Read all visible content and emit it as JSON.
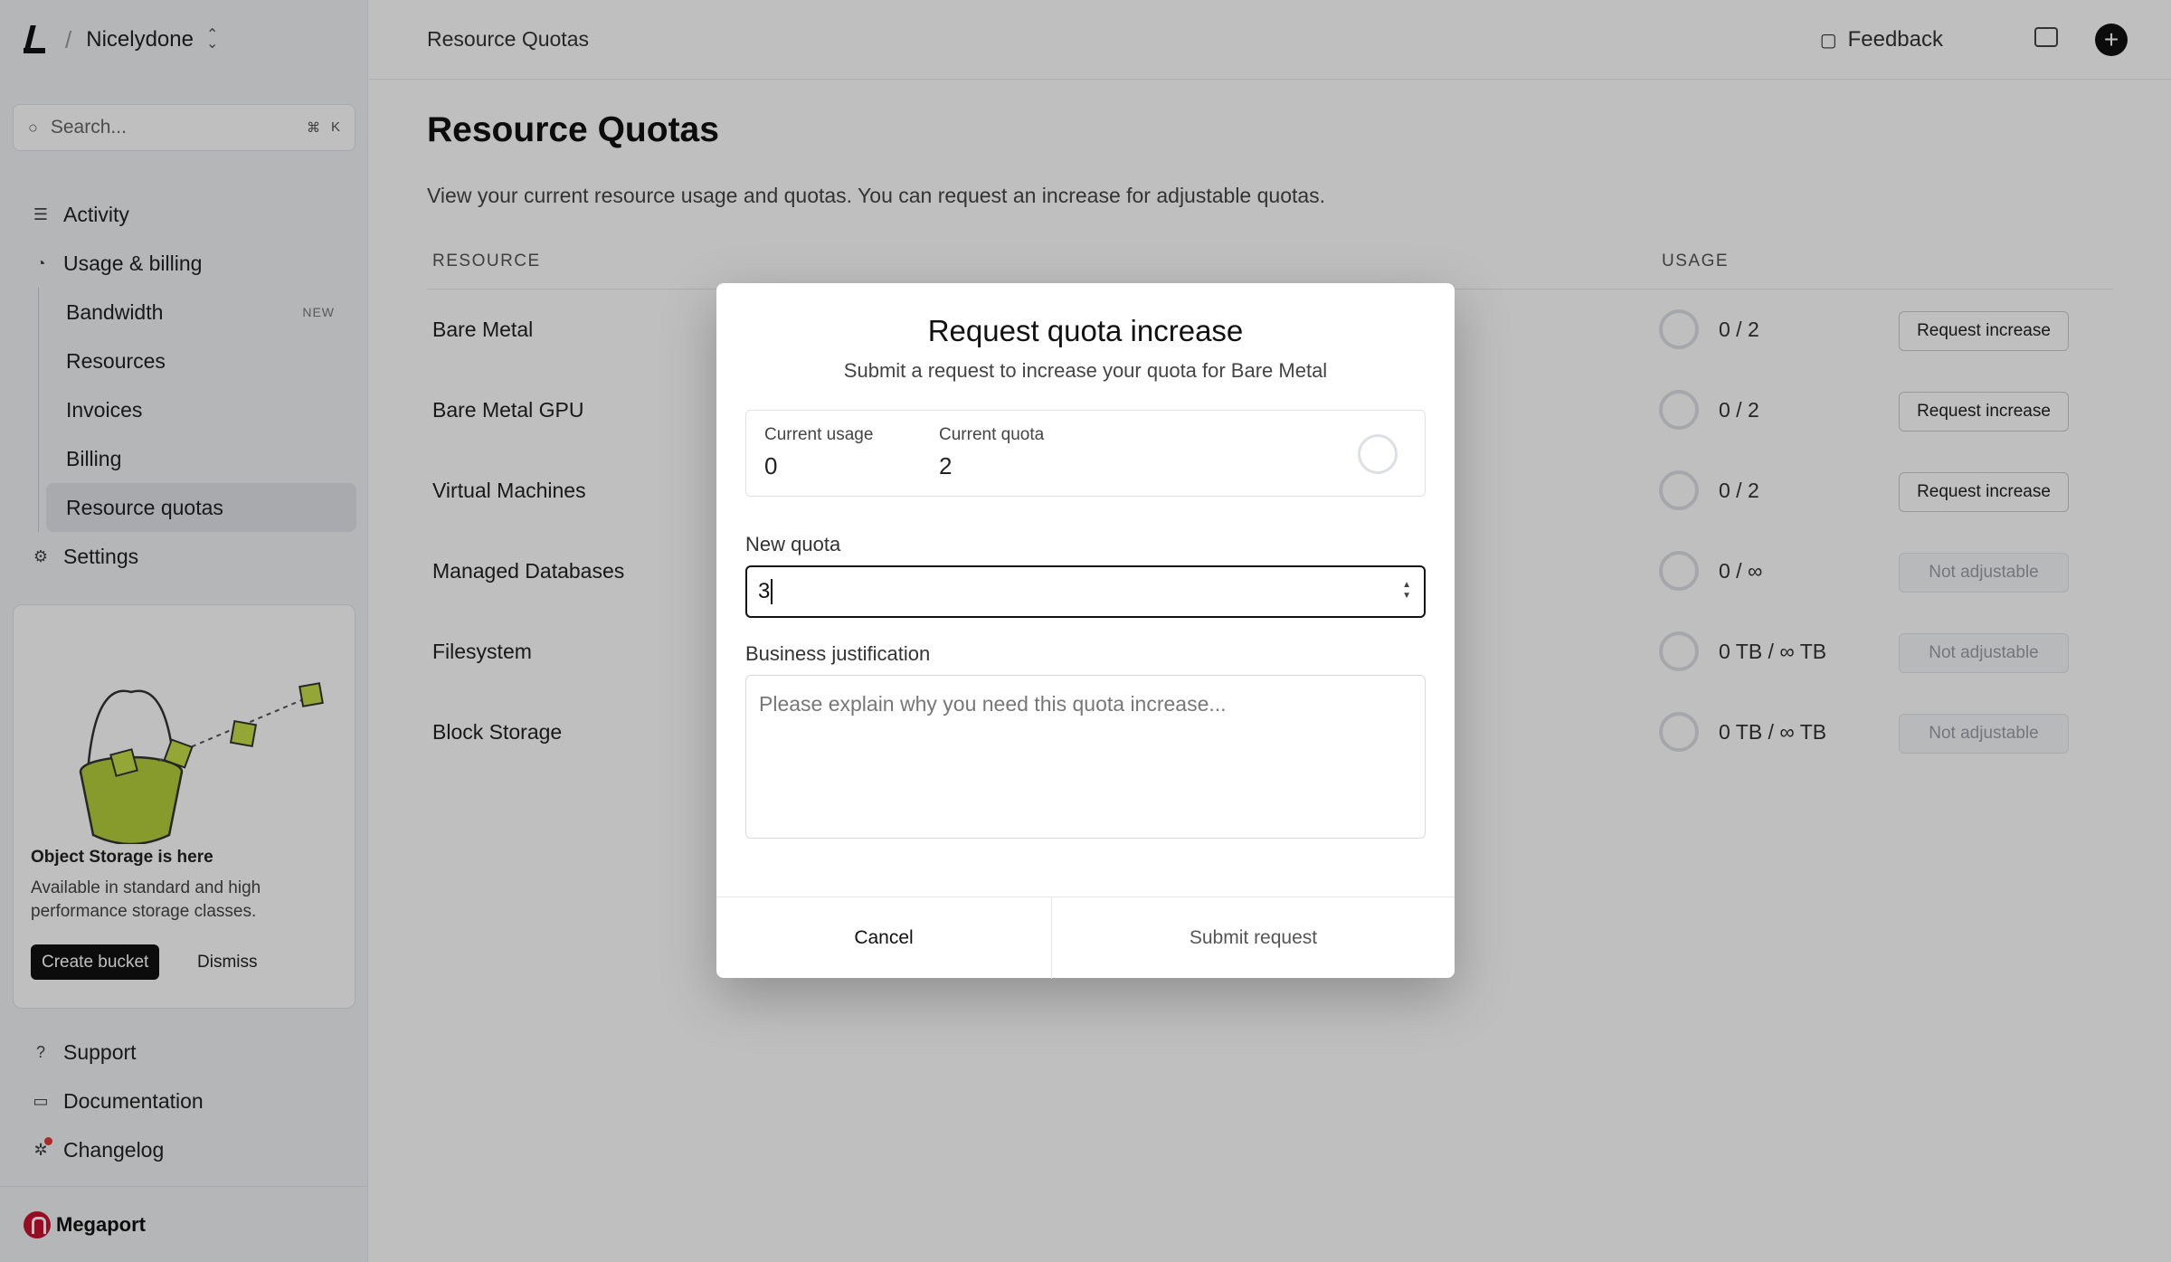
{
  "workspace": {
    "name": "Nicelydone"
  },
  "search": {
    "placeholder": "Search...",
    "shortcut_mod": "⌘",
    "shortcut_key": "K"
  },
  "sidebar": {
    "items": [
      {
        "label": "Activity",
        "icon": "list-icon"
      },
      {
        "label": "Usage & billing",
        "icon": "pie-chart-icon"
      }
    ],
    "billing_sub": [
      {
        "label": "Bandwidth",
        "badge": "NEW"
      },
      {
        "label": "Resources"
      },
      {
        "label": "Invoices"
      },
      {
        "label": "Billing"
      },
      {
        "label": "Resource quotas",
        "active": true
      }
    ],
    "settings": {
      "label": "Settings",
      "icon": "gear-icon"
    },
    "promo": {
      "title": "Object Storage is here",
      "text": "Available in standard and high performance storage classes.",
      "primary": "Create bucket",
      "secondary": "Dismiss"
    },
    "bottom": [
      {
        "label": "Support",
        "icon": "help-icon"
      },
      {
        "label": "Documentation",
        "icon": "book-icon"
      },
      {
        "label": "Changelog",
        "icon": "sparkle-icon"
      }
    ],
    "brand": "Megaport"
  },
  "topbar": {
    "breadcrumb": "Resource Quotas",
    "feedback": "Feedback"
  },
  "main": {
    "title": "Resource Quotas",
    "description": "View your current resource usage and quotas. You can request an increase for adjustable quotas.",
    "columns": [
      "RESOURCE",
      "USAGE"
    ],
    "rows": [
      {
        "name": "Bare Metal",
        "usage": "0 / 2",
        "action": "Request increase",
        "adjustable": true
      },
      {
        "name": "Bare Metal GPU",
        "usage": "0 / 2",
        "action": "Request increase",
        "adjustable": true
      },
      {
        "name": "Virtual Machines",
        "usage": "0 / 2",
        "action": "Request increase",
        "adjustable": true
      },
      {
        "name": "Managed Databases",
        "usage": "0 / ∞",
        "action": "Not adjustable",
        "adjustable": false
      },
      {
        "name": "Filesystem",
        "usage": "0 TB / ∞ TB",
        "action": "Not adjustable",
        "adjustable": false
      },
      {
        "name": "Block Storage",
        "usage": "0 TB / ∞ TB",
        "action": "Not adjustable",
        "adjustable": false
      }
    ]
  },
  "modal": {
    "title": "Request quota increase",
    "subtitle": "Submit a request to increase your quota for Bare Metal",
    "current_usage_label": "Current usage",
    "current_usage": "0",
    "current_quota_label": "Current quota",
    "current_quota": "2",
    "new_quota_label": "New quota",
    "new_quota_value": "3",
    "justification_label": "Business justification",
    "justification_placeholder": "Please explain why you need this quota increase...",
    "cancel": "Cancel",
    "submit": "Submit request"
  }
}
